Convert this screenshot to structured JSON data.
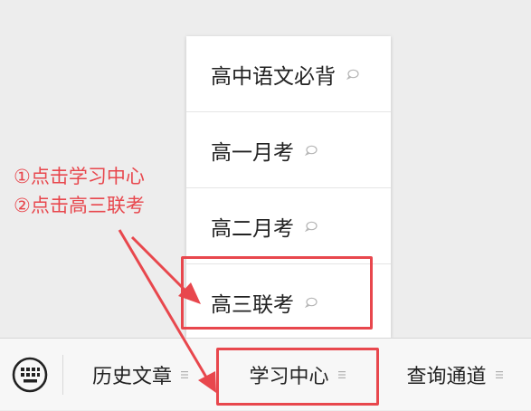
{
  "submenu": {
    "items": [
      {
        "label": "高中语文必背"
      },
      {
        "label": "高一月考"
      },
      {
        "label": "高二月考"
      },
      {
        "label": "高三联考"
      }
    ]
  },
  "bottombar": {
    "keyboard_icon": "keyboard-icon",
    "tabs": [
      {
        "label": "历史文章"
      },
      {
        "label": "学习中心"
      },
      {
        "label": "查询通道"
      }
    ]
  },
  "annotation": {
    "step1": "①点击学习中心",
    "step2": "②点击高三联考",
    "color": "#e8474d"
  }
}
